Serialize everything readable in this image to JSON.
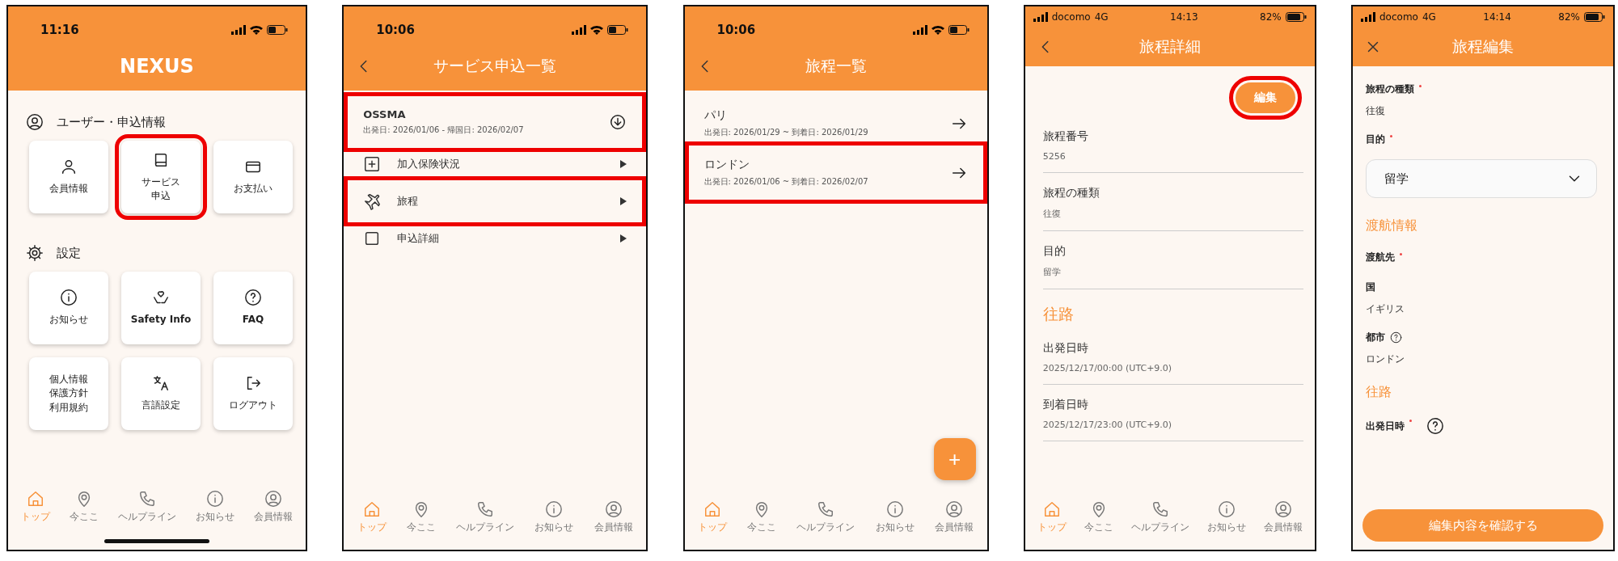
{
  "phones": [
    {
      "kind": "home",
      "status_bar": {
        "time": "11:16"
      },
      "header": {
        "title": "NEXUS"
      },
      "sections": [
        {
          "title": "ユーザー・申込情報",
          "tiles": [
            {
              "lines": [
                "会員情報"
              ],
              "highlighted": false
            },
            {
              "lines": [
                "サービス",
                "申込"
              ],
              "highlighted": true
            },
            {
              "lines": [
                "お支払い"
              ],
              "highlighted": false
            }
          ]
        },
        {
          "title": "設定",
          "tiles": [
            {
              "lines": [
                "お知らせ"
              ],
              "highlighted": false
            },
            {
              "lines": [
                "Safety Info"
              ],
              "highlighted": false
            },
            {
              "lines": [
                "FAQ"
              ],
              "highlighted": false
            },
            {
              "lines": [
                "個人情報",
                "保護方針",
                "利用規約"
              ],
              "highlighted": false
            },
            {
              "lines": [
                "言語設定"
              ],
              "highlighted": false
            },
            {
              "lines": [
                "ログアウト"
              ],
              "highlighted": false
            }
          ]
        }
      ],
      "nav": [
        {
          "label": "トップ",
          "selected": true
        },
        {
          "label": "今ここ",
          "selected": false
        },
        {
          "label": "ヘルプライン",
          "selected": false
        },
        {
          "label": "お知らせ",
          "selected": false
        },
        {
          "label": "会員情報",
          "selected": false
        }
      ],
      "home_indicator": true
    },
    {
      "kind": "list",
      "status_bar": {
        "time": "10:06"
      },
      "header": {
        "title": "サービス申込一覧"
      },
      "items": [
        {
          "kind": "application",
          "title": "OSSMA",
          "subtitle": "出発日: 2026/01/06 - 帰国日: 2026/02/07",
          "highlighted": true
        },
        {
          "kind": "menu",
          "label": "加入保険状況",
          "highlighted": false
        },
        {
          "kind": "menu",
          "label": "旅程",
          "highlighted": true
        },
        {
          "kind": "menu",
          "label": "申込詳細",
          "highlighted": false
        }
      ],
      "nav": [
        {
          "label": "トップ",
          "selected": true
        },
        {
          "label": "今ここ",
          "selected": false
        },
        {
          "label": "ヘルプライン",
          "selected": false
        },
        {
          "label": "お知らせ",
          "selected": false
        },
        {
          "label": "会員情報",
          "selected": false
        }
      ]
    },
    {
      "kind": "list",
      "status_bar": {
        "time": "10:06"
      },
      "header": {
        "title": "旅程一覧"
      },
      "items": [
        {
          "kind": "trip",
          "title": "パリ",
          "subtitle": "出発日: 2026/01/29 ~ 到着日: 2026/01/29",
          "highlighted": false
        },
        {
          "kind": "trip",
          "title": "ロンドン",
          "subtitle": "出発日: 2026/01/06 ~ 到着日: 2026/02/07",
          "highlighted": true
        }
      ],
      "fab": "+",
      "nav": [
        {
          "label": "トップ",
          "selected": true
        },
        {
          "label": "今ここ",
          "selected": false
        },
        {
          "label": "ヘルプライン",
          "selected": false
        },
        {
          "label": "お知らせ",
          "selected": false
        },
        {
          "label": "会員情報",
          "selected": false
        }
      ]
    },
    {
      "kind": "detail",
      "status_bar": {
        "carrier": "docomo",
        "network": "4G",
        "time": "14:13",
        "battery": "82%"
      },
      "header": {
        "title": "旅程詳細"
      },
      "edit_button": {
        "label": "編集",
        "highlighted": true
      },
      "rows": [
        {
          "kind": "field",
          "label": "旅程番号",
          "value": "5256"
        },
        {
          "kind": "field",
          "label": "旅程の種類",
          "value": "往復"
        },
        {
          "kind": "field",
          "label": "目的",
          "value": "留学"
        },
        {
          "kind": "section",
          "label": "往路"
        },
        {
          "kind": "field",
          "label": "出発日時",
          "value": "2025/12/17/00:00 (UTC+9.0)"
        },
        {
          "kind": "field",
          "label": "到着日時",
          "value": "2025/12/17/23:00 (UTC+9.0)"
        }
      ],
      "nav": [
        {
          "label": "トップ",
          "selected": true
        },
        {
          "label": "今ここ",
          "selected": false
        },
        {
          "label": "ヘルプライン",
          "selected": false
        },
        {
          "label": "お知らせ",
          "selected": false
        },
        {
          "label": "会員情報",
          "selected": false
        }
      ]
    },
    {
      "kind": "form",
      "status_bar": {
        "carrier": "docomo",
        "network": "4G",
        "time": "14:14",
        "battery": "82%"
      },
      "header": {
        "title": "旅程編集"
      },
      "rows": [
        {
          "kind": "label",
          "text": "旅程の種類",
          "required": true,
          "help": false
        },
        {
          "kind": "value",
          "text": "往復"
        },
        {
          "kind": "label",
          "text": "目的",
          "required": true,
          "help": false
        },
        {
          "kind": "select",
          "value": "留学"
        },
        {
          "kind": "section",
          "text": "渡航情報"
        },
        {
          "kind": "label",
          "text": "渡航先",
          "required": true,
          "help": false
        },
        {
          "kind": "label",
          "text": "国",
          "required": false,
          "help": false
        },
        {
          "kind": "value",
          "text": "イギリス"
        },
        {
          "kind": "label",
          "text": "都市",
          "required": false,
          "help": true
        },
        {
          "kind": "value",
          "text": "ロンドン"
        },
        {
          "kind": "section",
          "text": "往路"
        },
        {
          "kind": "label",
          "text": "出発日時",
          "required": true,
          "help": true
        }
      ],
      "submit": "編集内容を確認する"
    }
  ]
}
